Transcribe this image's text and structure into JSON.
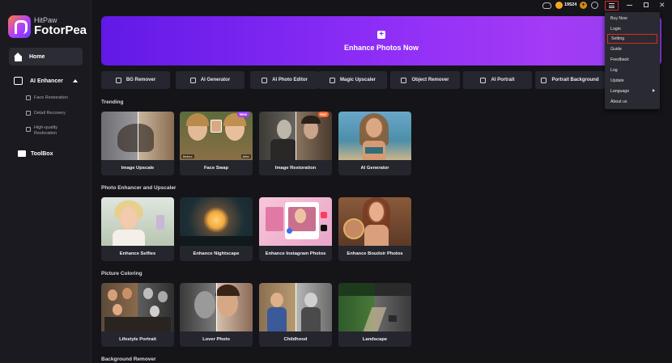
{
  "app": {
    "logo_small": "HitPaw",
    "logo_big": "FotorPea"
  },
  "sidebar": {
    "home_label": "Home",
    "ai_enhancer_label": "AI Enhancer",
    "sub_items": [
      {
        "label": "Face Restoration"
      },
      {
        "label": "Detail Recovery"
      },
      {
        "label": "High-quality\nRestoration"
      }
    ],
    "toolbox_label": "ToolBox"
  },
  "topbar": {
    "coin_count": "19524",
    "coin_plus": "+",
    "close_glyph": "✕"
  },
  "banner": {
    "plus": "+",
    "label": "Enhance Photos Now"
  },
  "tools": [
    {
      "label": "BG Remover",
      "icon": "bg-remover-icon"
    },
    {
      "label": "AI Generator",
      "icon": "ai-generator-icon"
    },
    {
      "label": "AI Photo Editor",
      "icon": "photo-editor-icon"
    },
    {
      "label": "Magic Upscaler",
      "icon": "upscaler-icon"
    },
    {
      "label": "Object Remover",
      "icon": "eraser-icon"
    },
    {
      "label": "AI Portrait",
      "icon": "portrait-icon"
    },
    {
      "label": "Portrait Background",
      "icon": "portrait-bg-icon"
    }
  ],
  "sections": [
    {
      "title": "Trending",
      "cards": [
        {
          "label": "Image Upscale"
        },
        {
          "label": "Face Swap",
          "badge": "New",
          "before": "Before",
          "after": "After"
        },
        {
          "label": "Image Restoration",
          "badge": "Hot"
        },
        {
          "label": "AI Generator"
        }
      ]
    },
    {
      "title": "Photo Enhancer and Upscaler",
      "cards": [
        {
          "label": "Enhance Selfies"
        },
        {
          "label": "Enhance Nightscape"
        },
        {
          "label": "Enhance Instagram Photos"
        },
        {
          "label": "Enhance Boudoir Photos"
        }
      ]
    },
    {
      "title": "Picture Coloring",
      "cards": [
        {
          "label": "Lifestyle Portrait"
        },
        {
          "label": "Lover Photo"
        },
        {
          "label": "Childhood"
        },
        {
          "label": "Landscape"
        }
      ]
    },
    {
      "title": "Background Remover"
    }
  ],
  "dropdown": {
    "items": [
      {
        "label": "Buy Now"
      },
      {
        "label": "Login"
      },
      {
        "label": "Setting"
      },
      {
        "label": "Guide"
      },
      {
        "label": "Feedback"
      },
      {
        "label": "Log"
      },
      {
        "label": "Update"
      },
      {
        "label": "Language"
      },
      {
        "label": "About us"
      }
    ]
  },
  "colors": {
    "background": "#141419",
    "sidebar": "#1a1a20",
    "accent_purple": "#8a2cf6",
    "highlight_red": "#e12a2a",
    "badge_new": "#a040ff",
    "badge_hot": "#ff6a2a"
  }
}
